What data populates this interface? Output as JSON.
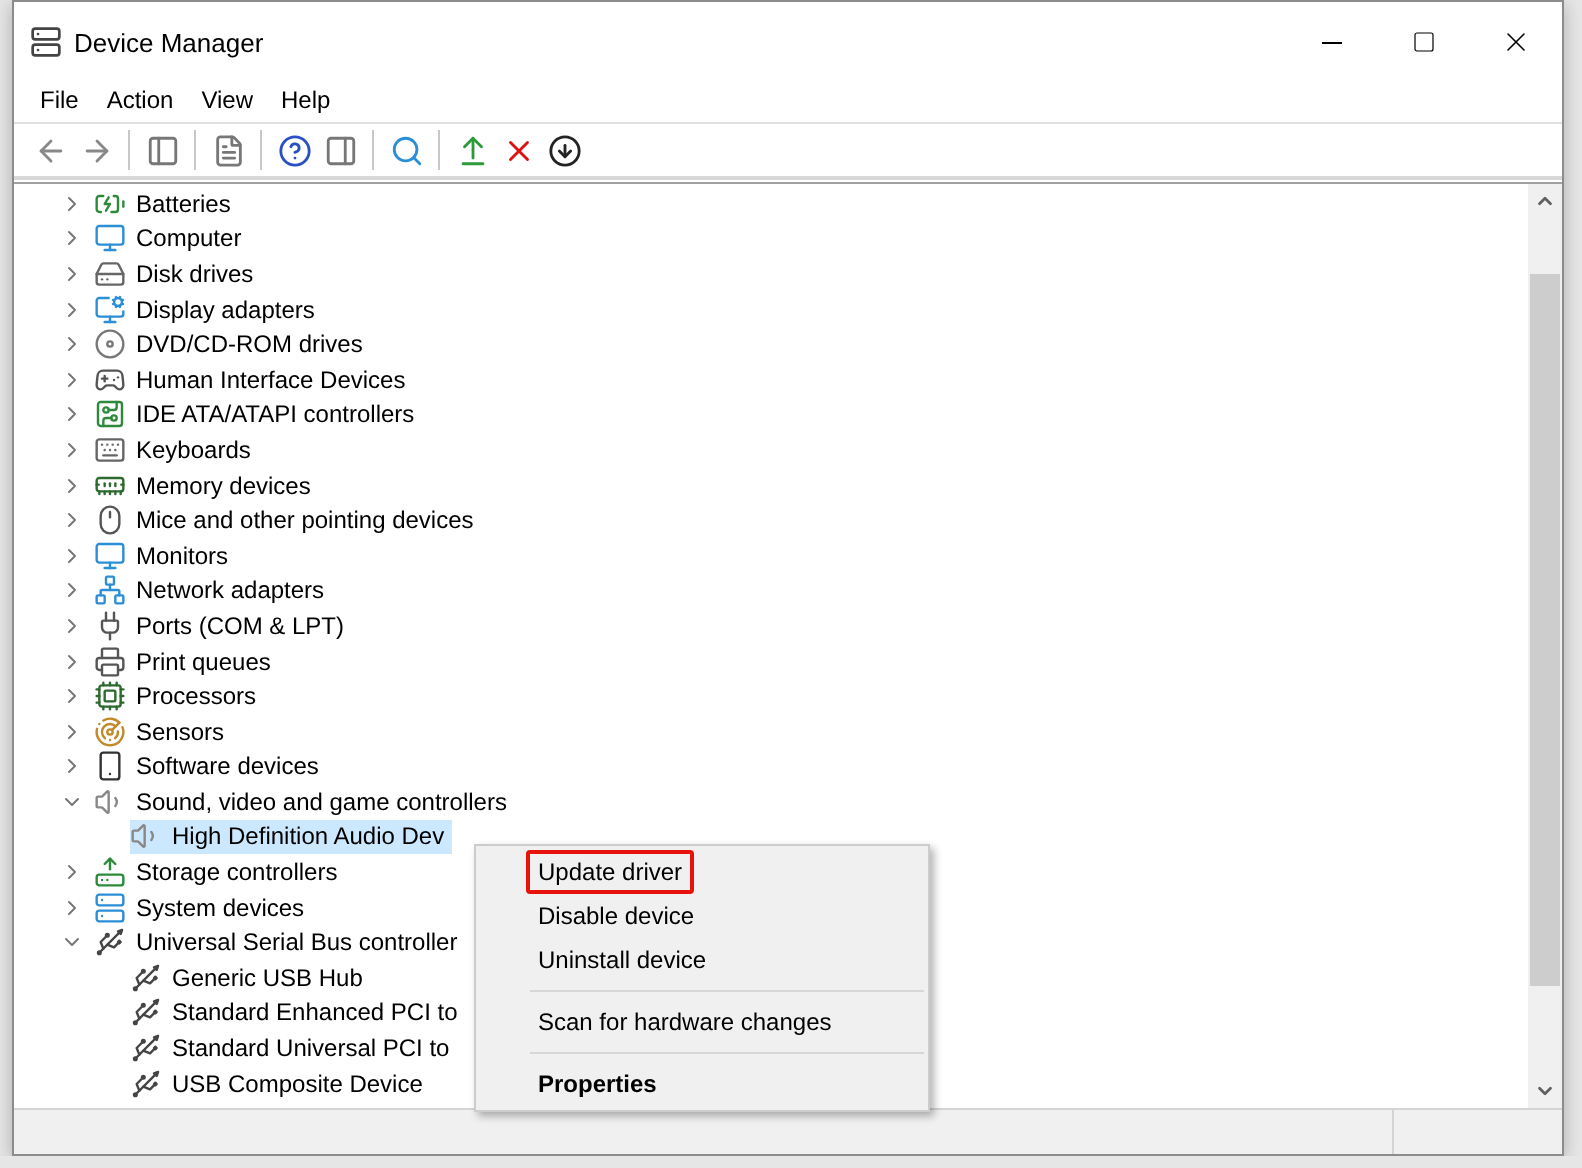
{
  "window": {
    "title": "Device Manager"
  },
  "menu_bar": [
    "File",
    "Action",
    "View",
    "Help"
  ],
  "tree": [
    {
      "label": "Batteries",
      "expanded": false,
      "selected": false
    },
    {
      "label": "Computer",
      "expanded": false,
      "selected": false
    },
    {
      "label": "Disk drives",
      "expanded": false,
      "selected": false
    },
    {
      "label": "Display adapters",
      "expanded": false,
      "selected": false
    },
    {
      "label": "DVD/CD-ROM drives",
      "expanded": false,
      "selected": false
    },
    {
      "label": "Human Interface Devices",
      "expanded": false,
      "selected": false
    },
    {
      "label": "IDE ATA/ATAPI controllers",
      "expanded": false,
      "selected": false
    },
    {
      "label": "Keyboards",
      "expanded": false,
      "selected": false
    },
    {
      "label": "Memory devices",
      "expanded": false,
      "selected": false
    },
    {
      "label": "Mice and other pointing devices",
      "expanded": false,
      "selected": false
    },
    {
      "label": "Monitors",
      "expanded": false,
      "selected": false
    },
    {
      "label": "Network adapters",
      "expanded": false,
      "selected": false
    },
    {
      "label": "Ports (COM & LPT)",
      "expanded": false,
      "selected": false
    },
    {
      "label": "Print queues",
      "expanded": false,
      "selected": false
    },
    {
      "label": "Processors",
      "expanded": false,
      "selected": false
    },
    {
      "label": "Sensors",
      "expanded": false,
      "selected": false
    },
    {
      "label": "Software devices",
      "expanded": false,
      "selected": false
    },
    {
      "label": "Sound, video and game controllers",
      "expanded": true,
      "selected": false,
      "children": [
        {
          "label": "High Definition Audio Dev",
          "selected": true
        }
      ]
    },
    {
      "label": "Storage controllers",
      "expanded": false,
      "selected": false
    },
    {
      "label": "System devices",
      "expanded": false,
      "selected": false
    },
    {
      "label": "Universal Serial Bus controller",
      "expanded": true,
      "selected": false,
      "children": [
        {
          "label": "Generic USB Hub",
          "selected": false
        },
        {
          "label": "Standard Enhanced PCI to",
          "selected": false
        },
        {
          "label": "Standard Universal PCI to",
          "selected": false
        },
        {
          "label": "USB Composite Device",
          "selected": false
        }
      ]
    }
  ],
  "context_menu": {
    "items": [
      {
        "kind": "item",
        "label": "Update driver",
        "highlighted": true,
        "default": false
      },
      {
        "kind": "item",
        "label": "Disable device",
        "highlighted": false,
        "default": false
      },
      {
        "kind": "item",
        "label": "Uninstall device",
        "highlighted": false,
        "default": false
      },
      {
        "kind": "separator"
      },
      {
        "kind": "item",
        "label": "Scan for hardware changes",
        "highlighted": false,
        "default": false
      },
      {
        "kind": "separator"
      },
      {
        "kind": "item",
        "label": "Properties",
        "highlighted": false,
        "default": true
      }
    ]
  }
}
